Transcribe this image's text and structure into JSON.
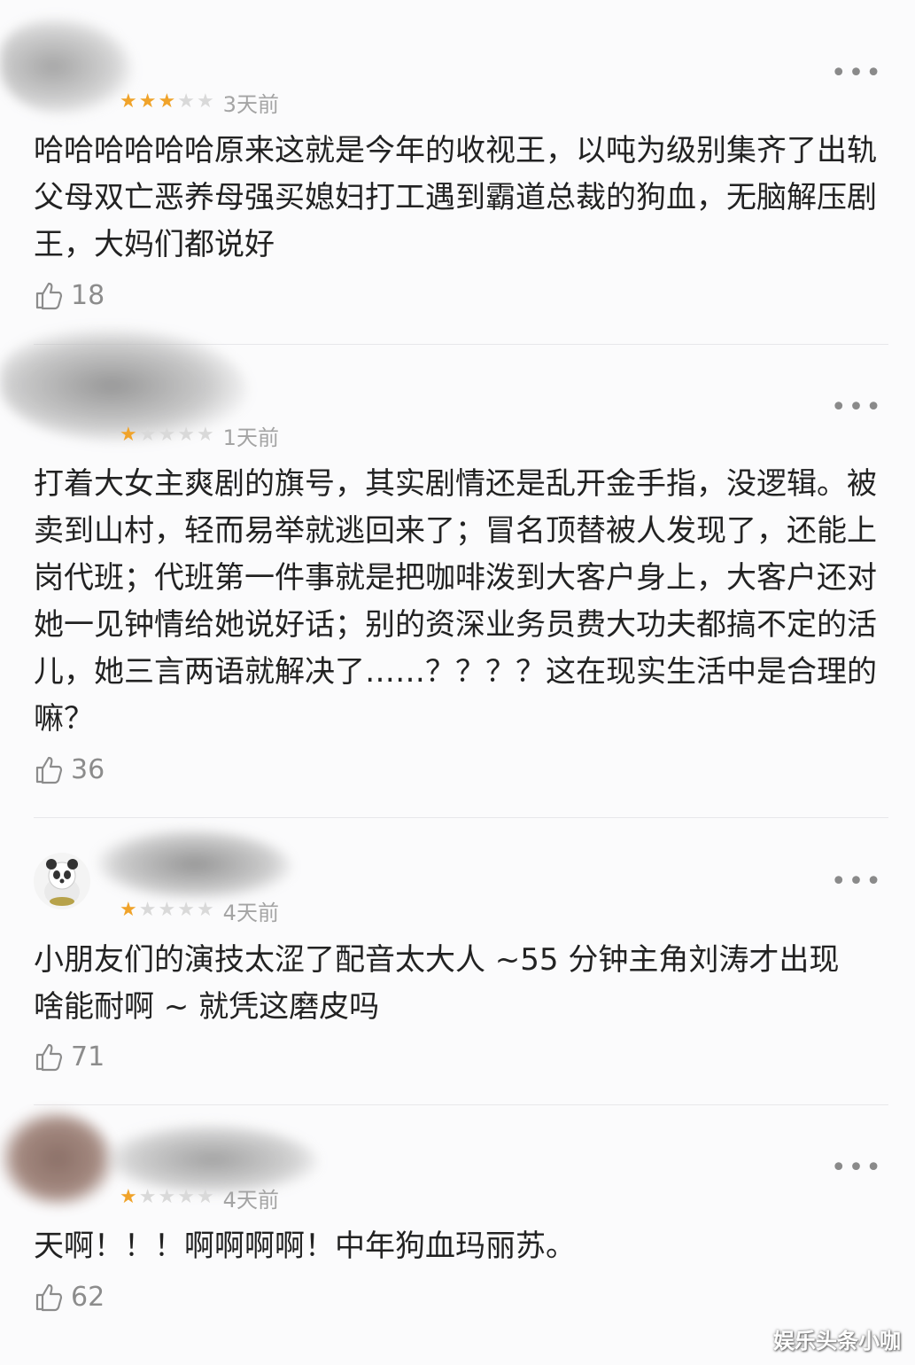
{
  "comments": [
    {
      "rating": 3,
      "time": "3天前",
      "text": "哈哈哈哈哈哈原来这就是今年的收视王，以吨为级别集齐了出轨父母双亡恶养母强买媳妇打工遇到霸道总裁的狗血，无脑解压剧王，大妈们都说好",
      "likes": "18"
    },
    {
      "rating": 1,
      "time": "1天前",
      "text": "打着大女主爽剧的旗号，其实剧情还是乱开金手指，没逻辑。被卖到山村，轻而易举就逃回来了；冒名顶替被人发现了，还能上岗代班；代班第一件事就是把咖啡泼到大客户身上，大客户还对她一见钟情给她说好话；别的资深业务员费大功夫都搞不定的活儿，她三言两语就解决了……？？？？这在现实生活中是合理的嘛？",
      "likes": "36"
    },
    {
      "rating": 1,
      "time": "4天前",
      "text": "小朋友们的演技太涩了配音太大人 ~55 分钟主角刘涛才出现啥能耐啊 ~ 就凭这磨皮吗",
      "likes": "71"
    },
    {
      "rating": 1,
      "time": "4天前",
      "text": "天啊！！！啊啊啊啊！中年狗血玛丽苏。",
      "likes": "62"
    }
  ],
  "ui": {
    "more_glyph": "•••",
    "star_glyph": "★",
    "icons": {
      "like": "thumbs-up-icon",
      "more": "more-dots-icon",
      "avatar": "panda-avatar-icon"
    },
    "colors": {
      "star_on": "#f0a32a",
      "star_off": "#d9d9d9",
      "meta": "#a4a4a4"
    }
  },
  "watermark": "娱乐头条小咖"
}
